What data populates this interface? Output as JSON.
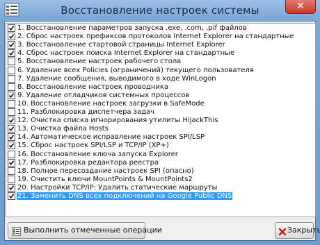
{
  "window": {
    "title": "Восстановление настроек системы",
    "close_glyph": "✕"
  },
  "items": [
    {
      "label": "1. Восстановление параметров запуска .exe, .com, .pif файлов",
      "checked": true,
      "selected": false
    },
    {
      "label": "2. Сброс настроек префиксов протоколов Internet Explorer на стандартные",
      "checked": true,
      "selected": false
    },
    {
      "label": "3. Восстановление стартовой страницы Internet Explorer",
      "checked": true,
      "selected": false
    },
    {
      "label": "4. Сброс настроек поиска Internet Explorer на стандартные",
      "checked": true,
      "selected": false
    },
    {
      "label": "5. Восстановление настроек рабочего стола",
      "checked": false,
      "selected": false
    },
    {
      "label": "6. Удаление всех Policies (ограничений) текущего пользователя",
      "checked": false,
      "selected": false
    },
    {
      "label": "7. Удаление сообщения, выводимого в ходе WinLogon",
      "checked": false,
      "selected": false
    },
    {
      "label": "8. Восстановление настроек проводника",
      "checked": false,
      "selected": false
    },
    {
      "label": "9. Удаление отладчиков системных процессов",
      "checked": true,
      "selected": false
    },
    {
      "label": "10. Восстановление настроек загрузки в SafeMode",
      "checked": false,
      "selected": false
    },
    {
      "label": "11. Разблокировка диспетчера задач",
      "checked": false,
      "selected": false
    },
    {
      "label": "12. Очистка списка игнорирования утилиты HijackThis",
      "checked": true,
      "selected": false
    },
    {
      "label": "13. Очистка файла Hosts",
      "checked": true,
      "selected": false
    },
    {
      "label": "14. Автоматическое исправление настроек SPI/LSP",
      "checked": true,
      "selected": false
    },
    {
      "label": "15. Сброс настроек SPI/LSP и TCP/IP (XP+)",
      "checked": true,
      "selected": false
    },
    {
      "label": "16. Восстановление ключа запуска Explorer",
      "checked": false,
      "selected": false
    },
    {
      "label": "17. Разблокировка редактора реестра",
      "checked": true,
      "selected": false
    },
    {
      "label": "18. Полное пересоздание настроек SPI (опасно)",
      "checked": false,
      "selected": false
    },
    {
      "label": "19. Очистить ключи MountPoints & MountPoints2",
      "checked": false,
      "selected": false
    },
    {
      "label": "20. Настройки TCP/IP: Удалить статические маршруты",
      "checked": true,
      "selected": false
    },
    {
      "label": "21. Заменить DNS всех подключений на Google Public DNS",
      "checked": true,
      "selected": true
    }
  ],
  "buttons": {
    "run_label": "Выполнить отмеченные операции",
    "close_label": "Закрыть"
  },
  "colors": {
    "selection": "#3399ff",
    "title_bar": "#7aa8d8",
    "close_button": "#c7372a"
  },
  "icons": {
    "app": "settings-list-icon",
    "run": "run-checklist-icon",
    "close": "red-x-icon"
  }
}
